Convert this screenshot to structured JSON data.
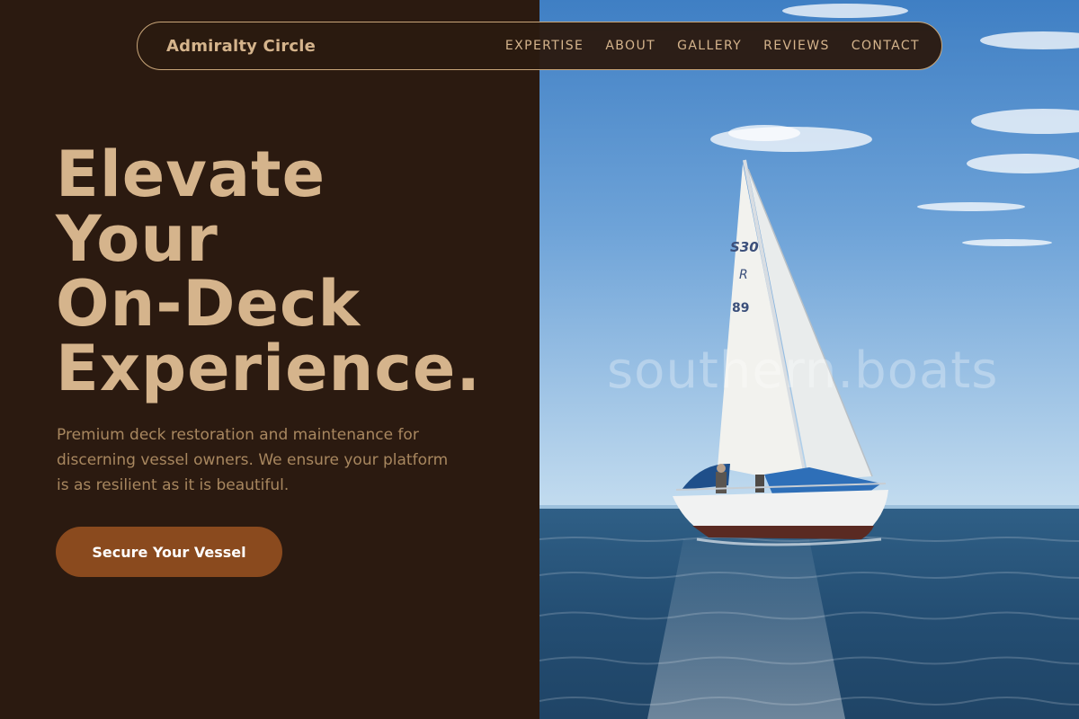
{
  "header": {
    "brand": "Admiralty Circle",
    "nav": [
      {
        "label": "EXPERTISE"
      },
      {
        "label": "ABOUT"
      },
      {
        "label": "GALLERY"
      },
      {
        "label": "REVIEWS"
      },
      {
        "label": "CONTACT"
      }
    ]
  },
  "hero": {
    "headline_lines": [
      "Elevate",
      "Your",
      "On-Deck",
      "Experience."
    ],
    "description": "Premium deck restoration and maintenance for discerning vessel owners. We ensure your platform is as resilient as it is beautiful.",
    "cta_label": "Secure Your Vessel"
  },
  "photo": {
    "watermark": "southern.boats",
    "sail_marks": [
      "S30",
      "R",
      "89"
    ]
  },
  "colors": {
    "background": "#2b1a10",
    "accent_text": "#d5b48c",
    "muted_text": "#a8875f",
    "button": "#8a4a1e",
    "nav_border": "#c9a679"
  }
}
